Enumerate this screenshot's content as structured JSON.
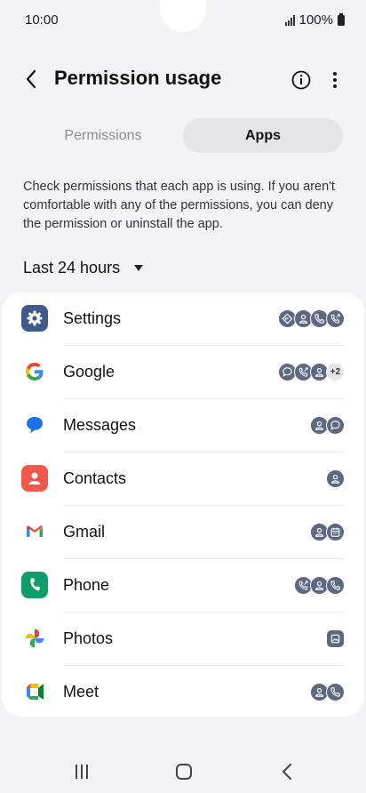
{
  "status": {
    "time": "10:00",
    "battery": "100%"
  },
  "appbar": {
    "title": "Permission usage"
  },
  "tabs": [
    {
      "label": "Permissions",
      "selected": false
    },
    {
      "label": "Apps",
      "selected": true
    }
  ],
  "description": "Check permissions that each app is using. If you aren't comfortable with any of the permissions, you can deny the permission or uninstall the app.",
  "range": {
    "label": "Last 24 hours"
  },
  "apps": [
    {
      "name": "Settings",
      "icon": "settings-icon",
      "permissions": [
        "location",
        "contacts",
        "phone",
        "call-logs"
      ],
      "extra": ""
    },
    {
      "name": "Google",
      "icon": "google-icon",
      "permissions": [
        "sms",
        "call-logs",
        "contacts"
      ],
      "extra": "+2"
    },
    {
      "name": "Messages",
      "icon": "messages-icon",
      "permissions": [
        "contacts",
        "sms"
      ],
      "extra": ""
    },
    {
      "name": "Contacts",
      "icon": "contacts-icon",
      "permissions": [
        "contacts"
      ],
      "extra": ""
    },
    {
      "name": "Gmail",
      "icon": "gmail-icon",
      "permissions": [
        "contacts",
        "calendar"
      ],
      "extra": ""
    },
    {
      "name": "Phone",
      "icon": "phone-icon",
      "permissions": [
        "call-logs",
        "contacts",
        "phone"
      ],
      "extra": ""
    },
    {
      "name": "Photos",
      "icon": "photos-icon",
      "permissions": [
        "photos"
      ],
      "extra": ""
    },
    {
      "name": "Meet",
      "icon": "meet-icon",
      "permissions": [
        "contacts",
        "phone"
      ],
      "extra": ""
    }
  ],
  "colors": {
    "background": "#f3f3f6",
    "card": "#ffffff",
    "chip": "#5d6882",
    "tab_selected": "#e5e5e8"
  }
}
